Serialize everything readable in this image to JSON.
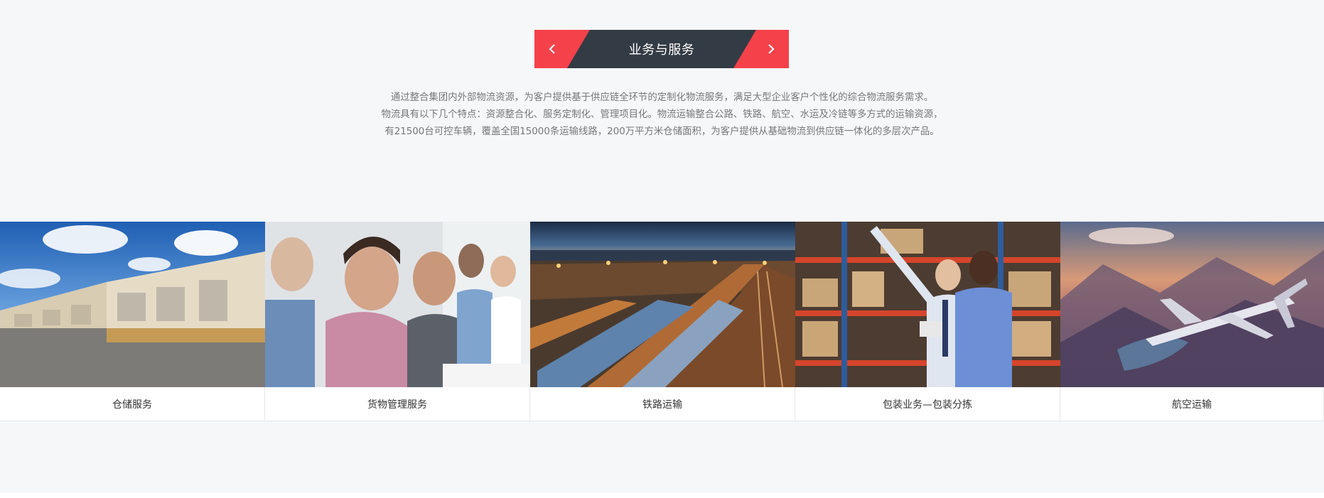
{
  "banner": {
    "title": "业务与服务",
    "prev_icon": "chevron-left-icon",
    "next_icon": "chevron-right-icon"
  },
  "intro": {
    "lines": [
      "通过整合集团内外部物流资源，为客户提供基于供应链全环节的定制化物流服务，满足大型企业客户个性化的综合物流服务需求。",
      "物流具有以下几个特点：资源整合化、服务定制化、管理项目化。物流运输整合公路、铁路、航空、水运及冷链等多方式的运输资源，",
      "有21500台可控车辆，覆盖全国15000条运输线路，200万平方米仓储面积，为客户提供从基础物流到供应链一体化的多层次产品。"
    ]
  },
  "services": [
    {
      "label": "仓储服务",
      "image": "warehouse-photo"
    },
    {
      "label": "货物管理服务",
      "image": "team-applause-photo"
    },
    {
      "label": "铁路运输",
      "image": "rail-yard-photo"
    },
    {
      "label": "包装业务—包装分拣",
      "image": "shelving-inspection-photo"
    },
    {
      "label": "航空运输",
      "image": "airplane-photo"
    }
  ],
  "colors": {
    "accent": "#f5414a",
    "banner_dark": "#333b44",
    "section_bg": "#f6f7f9"
  }
}
